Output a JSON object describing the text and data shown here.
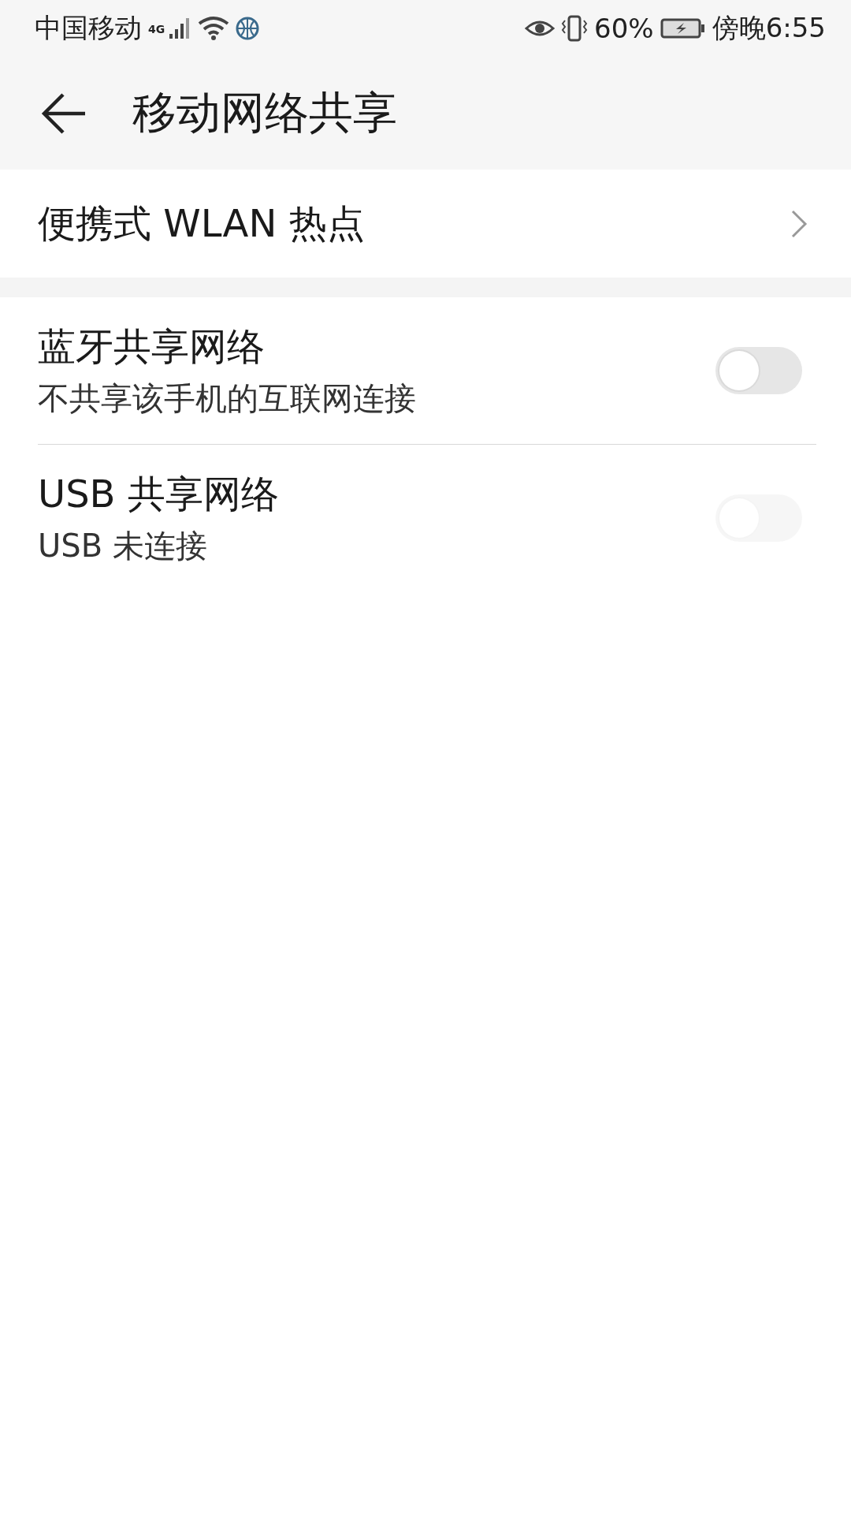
{
  "status_bar": {
    "carrier": "中国移动",
    "network": "4G",
    "battery_percent": "60%",
    "time": "傍晚6:55"
  },
  "header": {
    "title": "移动网络共享"
  },
  "items": [
    {
      "kind": "link",
      "title": "便携式 WLAN 热点"
    },
    {
      "kind": "switch",
      "title": "蓝牙共享网络",
      "subtitle": "不共享该手机的互联网连接",
      "on": false,
      "disabled": false
    },
    {
      "kind": "switch",
      "title": "USB 共享网络",
      "subtitle": "USB 未连接",
      "on": false,
      "disabled": true
    }
  ]
}
